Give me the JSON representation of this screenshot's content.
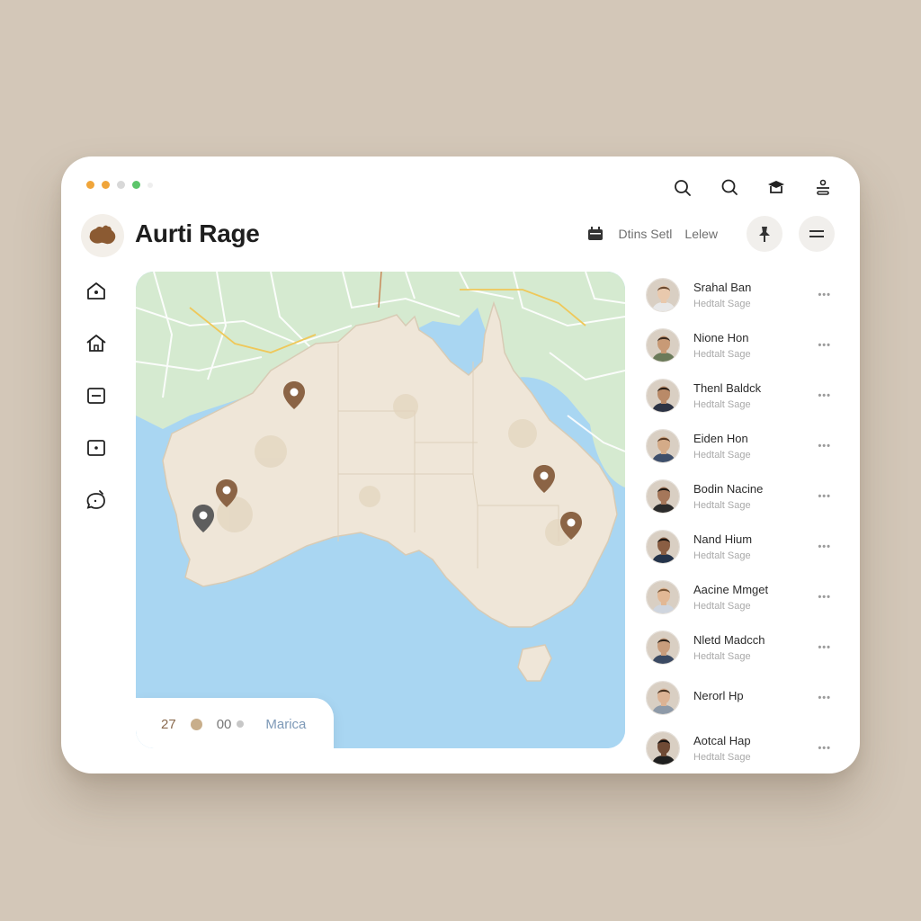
{
  "app": {
    "title": "Aurti Rage"
  },
  "window": {
    "traffic_lights": [
      "#f0a53a",
      "#f0a53a",
      "#d8d8d8",
      "#5cc56a",
      "#eeeeee"
    ]
  },
  "toolbar": {
    "icons": [
      "search-icon",
      "search-alt-icon",
      "graduation-cap-icon",
      "settings-icon"
    ]
  },
  "header": {
    "filter_label": "Dtins Setl",
    "view_label": "Lelew"
  },
  "sidebar": {
    "items": [
      "home-dot-icon",
      "house-icon",
      "minus-box-icon",
      "dot-box-icon",
      "chat-bubble-icon"
    ]
  },
  "map": {
    "footer": {
      "count": "27",
      "value": "00",
      "place": "Marica"
    },
    "colors": {
      "ocean": "#a9d6f2",
      "land": "#efe6d8",
      "green": "#d5ead0",
      "pin_brown": "#8b6445",
      "pin_gray": "#5e5e5e"
    }
  },
  "people": [
    {
      "name": "Srahal Ban",
      "subtitle": "Hedtalt Sage"
    },
    {
      "name": "Nione Hon",
      "subtitle": "Hedtalt Sage"
    },
    {
      "name": "Thenl Baldck",
      "subtitle": "Hedtalt Sage"
    },
    {
      "name": "Eiden Hon",
      "subtitle": "Hedtalt Sage"
    },
    {
      "name": "Bodin Nacine",
      "subtitle": "Hedtalt Sage"
    },
    {
      "name": "Nand Hium",
      "subtitle": "Hedtalt Sage"
    },
    {
      "name": "Aacine Mmget",
      "subtitle": "Hedtalt Sage"
    },
    {
      "name": "Nletd Madcch",
      "subtitle": "Hedtalt Sage"
    },
    {
      "name": "Nerorl Hp",
      "subtitle": ""
    },
    {
      "name": "Aotcal Hap",
      "subtitle": "Hedtalt Sage"
    }
  ],
  "more_label": "•••"
}
